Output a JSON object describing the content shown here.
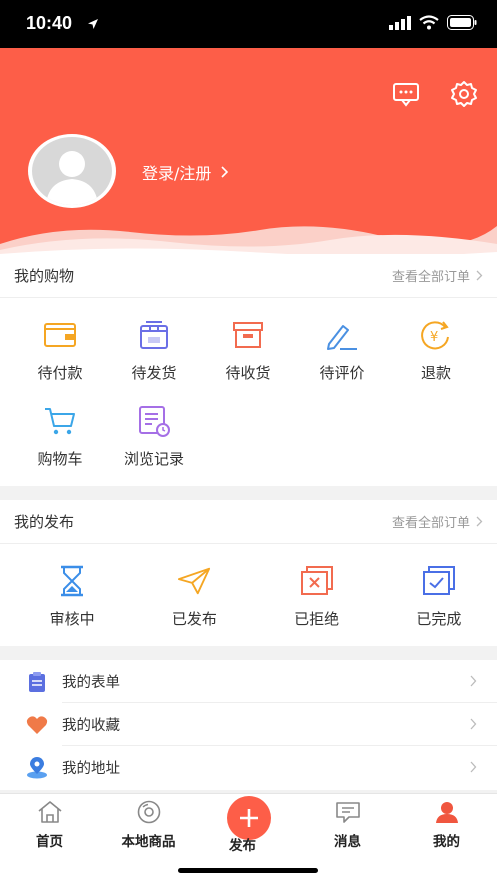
{
  "status_bar": {
    "time": "10:40"
  },
  "header": {
    "login_label": "登录/注册",
    "accent_color": "#fd5e48"
  },
  "shopping": {
    "title": "我的购物",
    "view_all": "查看全部订单",
    "items": [
      {
        "label": "待付款",
        "icon": "wallet-icon",
        "color": "#f5a623"
      },
      {
        "label": "待发货",
        "icon": "package-icon",
        "color": "#6b6fe6"
      },
      {
        "label": "待收货",
        "icon": "box-icon",
        "color": "#f26b4f"
      },
      {
        "label": "待评价",
        "icon": "pen-icon",
        "color": "#4a90e2"
      },
      {
        "label": "退款",
        "icon": "refund-icon",
        "color": "#f5a623"
      },
      {
        "label": "购物车",
        "icon": "cart-icon",
        "color": "#3ba6e8"
      },
      {
        "label": "浏览记录",
        "icon": "history-icon",
        "color": "#a56fe6"
      }
    ]
  },
  "publish": {
    "title": "我的发布",
    "view_all": "查看全部订单",
    "items": [
      {
        "label": "审核中",
        "icon": "hourglass-icon",
        "color": "#3b8ee8"
      },
      {
        "label": "已发布",
        "icon": "send-icon",
        "color": "#f5a623"
      },
      {
        "label": "已拒绝",
        "icon": "rejected-icon",
        "color": "#f26b4f"
      },
      {
        "label": "已完成",
        "icon": "completed-icon",
        "color": "#4a6fe6"
      }
    ]
  },
  "menu": [
    {
      "label": "我的表单",
      "icon": "form-icon"
    },
    {
      "label": "我的收藏",
      "icon": "heart-icon"
    },
    {
      "label": "我的地址",
      "icon": "location-icon"
    }
  ],
  "tabbar": {
    "tabs": [
      {
        "label": "首页",
        "icon": "home-icon"
      },
      {
        "label": "本地商品",
        "icon": "disc-icon"
      },
      {
        "label": "发布",
        "icon": "plus-icon"
      },
      {
        "label": "消息",
        "icon": "message-icon"
      },
      {
        "label": "我的",
        "icon": "user-icon"
      }
    ]
  }
}
